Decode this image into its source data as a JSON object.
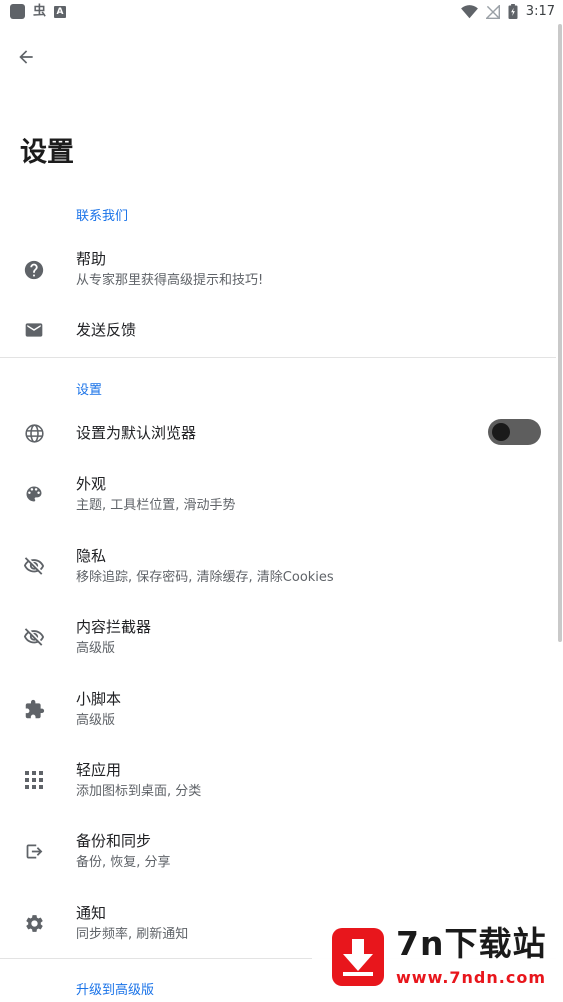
{
  "status_bar": {
    "left_icons": [
      "notification-square-icon",
      "bug-icon",
      "a-badge-icon"
    ],
    "bug_glyph": "虫",
    "a_glyph": "A",
    "right_icons": [
      "wifi-icon",
      "no-signal-icon",
      "battery-icon"
    ],
    "time": "3:17"
  },
  "header": {
    "back_icon": "arrow-left-icon",
    "title": "设置"
  },
  "sections": [
    {
      "header": "联系我们",
      "items": [
        {
          "icon": "help-circle-icon",
          "title": "帮助",
          "subtitle": "从专家那里获得高级提示和技巧!"
        },
        {
          "icon": "mail-icon",
          "title": "发送反馈",
          "subtitle": ""
        }
      ]
    },
    {
      "header": "设置",
      "items": [
        {
          "icon": "globe-icon",
          "title": "设置为默认浏览器",
          "subtitle": "",
          "toggle": false
        },
        {
          "icon": "palette-icon",
          "title": "外观",
          "subtitle": "主题, 工具栏位置, 滑动手势"
        },
        {
          "icon": "eye-off-icon",
          "title": "隐私",
          "subtitle": "移除追踪, 保存密码, 清除缓存, 清除Cookies"
        },
        {
          "icon": "eye-off-icon",
          "title": "内容拦截器",
          "subtitle": "高级版"
        },
        {
          "icon": "puzzle-icon",
          "title": "小脚本",
          "subtitle": "高级版"
        },
        {
          "icon": "apps-grid-icon",
          "title": "轻应用",
          "subtitle": "添加图标到桌面, 分类"
        },
        {
          "icon": "export-icon",
          "title": "备份和同步",
          "subtitle": "备份, 恢复, 分享"
        },
        {
          "icon": "gear-icon",
          "title": "通知",
          "subtitle": "同步频率, 刷新通知"
        }
      ]
    },
    {
      "header": "升级到高级版",
      "items": []
    }
  ],
  "watermark": {
    "title": "7n下载站",
    "url": "www.7ndn.com"
  },
  "colors": {
    "accent": "#1a73e8",
    "icon": "#5f6368",
    "watermark_red": "#e8161c"
  }
}
